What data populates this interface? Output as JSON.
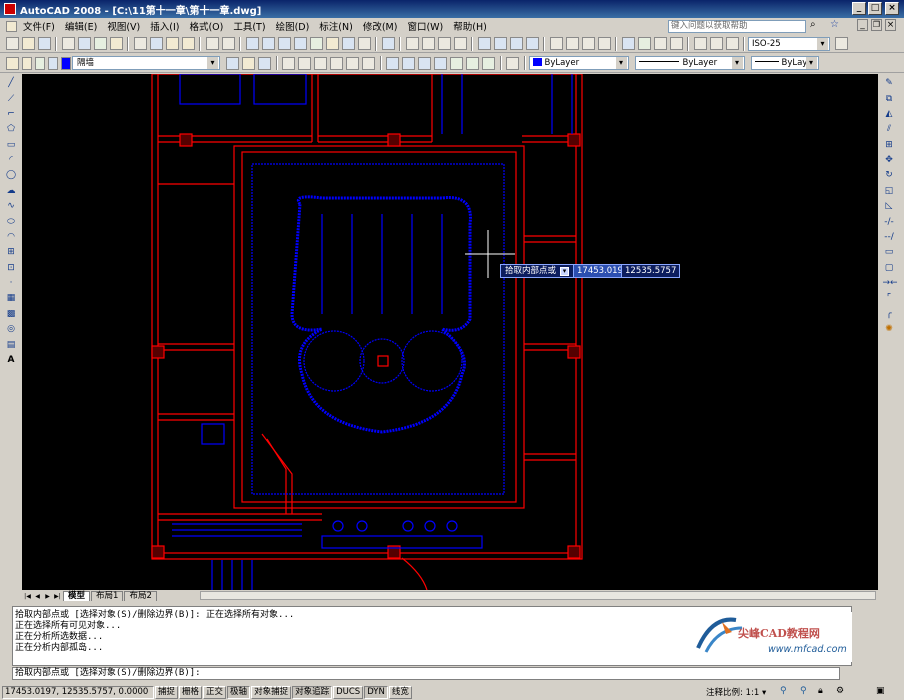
{
  "window": {
    "title": "AutoCAD 2008 - [C:\\11第十一章\\第十一章.dwg]",
    "min": "_",
    "max": "□",
    "close": "×"
  },
  "menu": [
    "文件(F)",
    "编辑(E)",
    "视图(V)",
    "插入(I)",
    "格式(O)",
    "工具(T)",
    "绘图(D)",
    "标注(N)",
    "修改(M)",
    "窗口(W)",
    "帮助(H)"
  ],
  "help_search_placeholder": "键入问题以获取帮助",
  "toolbar2": {
    "dimstyle": "ISO-25"
  },
  "toolbar3": {
    "layer": "隔墙",
    "color": "ByLayer",
    "linetype": "ByLayer",
    "lineweight": "ByLayer"
  },
  "colors": {
    "wall": "#ff0000",
    "furniture": "#0000ff",
    "canvas": "#000000",
    "crosshair": "#ffffff"
  },
  "cursor_tooltip": {
    "prompt": "拾取内部点或",
    "x": "17453.0197",
    "y": "12535.5757"
  },
  "layout_tabs": [
    "模型",
    "布局1",
    "布局2"
  ],
  "command_history": [
    "拾取内部点或 [选择对象(S)/删除边界(B)]:  正在选择所有对象...",
    "正在选择所有可见对象...",
    "正在分析所选数据...",
    "正在分析内部孤岛..."
  ],
  "command_prompt": "拾取内部点或 [选择对象(S)/删除边界(B)]:",
  "logo": {
    "title": "尖峰CAD教程网",
    "url": "www.mfcad.com"
  },
  "status": {
    "coords": "17453.0197, 12535.5757, 0.0000",
    "toggles": [
      {
        "label": "捕捉",
        "on": false
      },
      {
        "label": "栅格",
        "on": false
      },
      {
        "label": "正交",
        "on": false
      },
      {
        "label": "极轴",
        "on": true
      },
      {
        "label": "对象捕捉",
        "on": false
      },
      {
        "label": "对象追踪",
        "on": true
      },
      {
        "label": "DUCS",
        "on": false
      },
      {
        "label": "DYN",
        "on": true
      },
      {
        "label": "线宽",
        "on": false
      }
    ],
    "annotation_scale": "注释比例: 1:1 ▾"
  }
}
